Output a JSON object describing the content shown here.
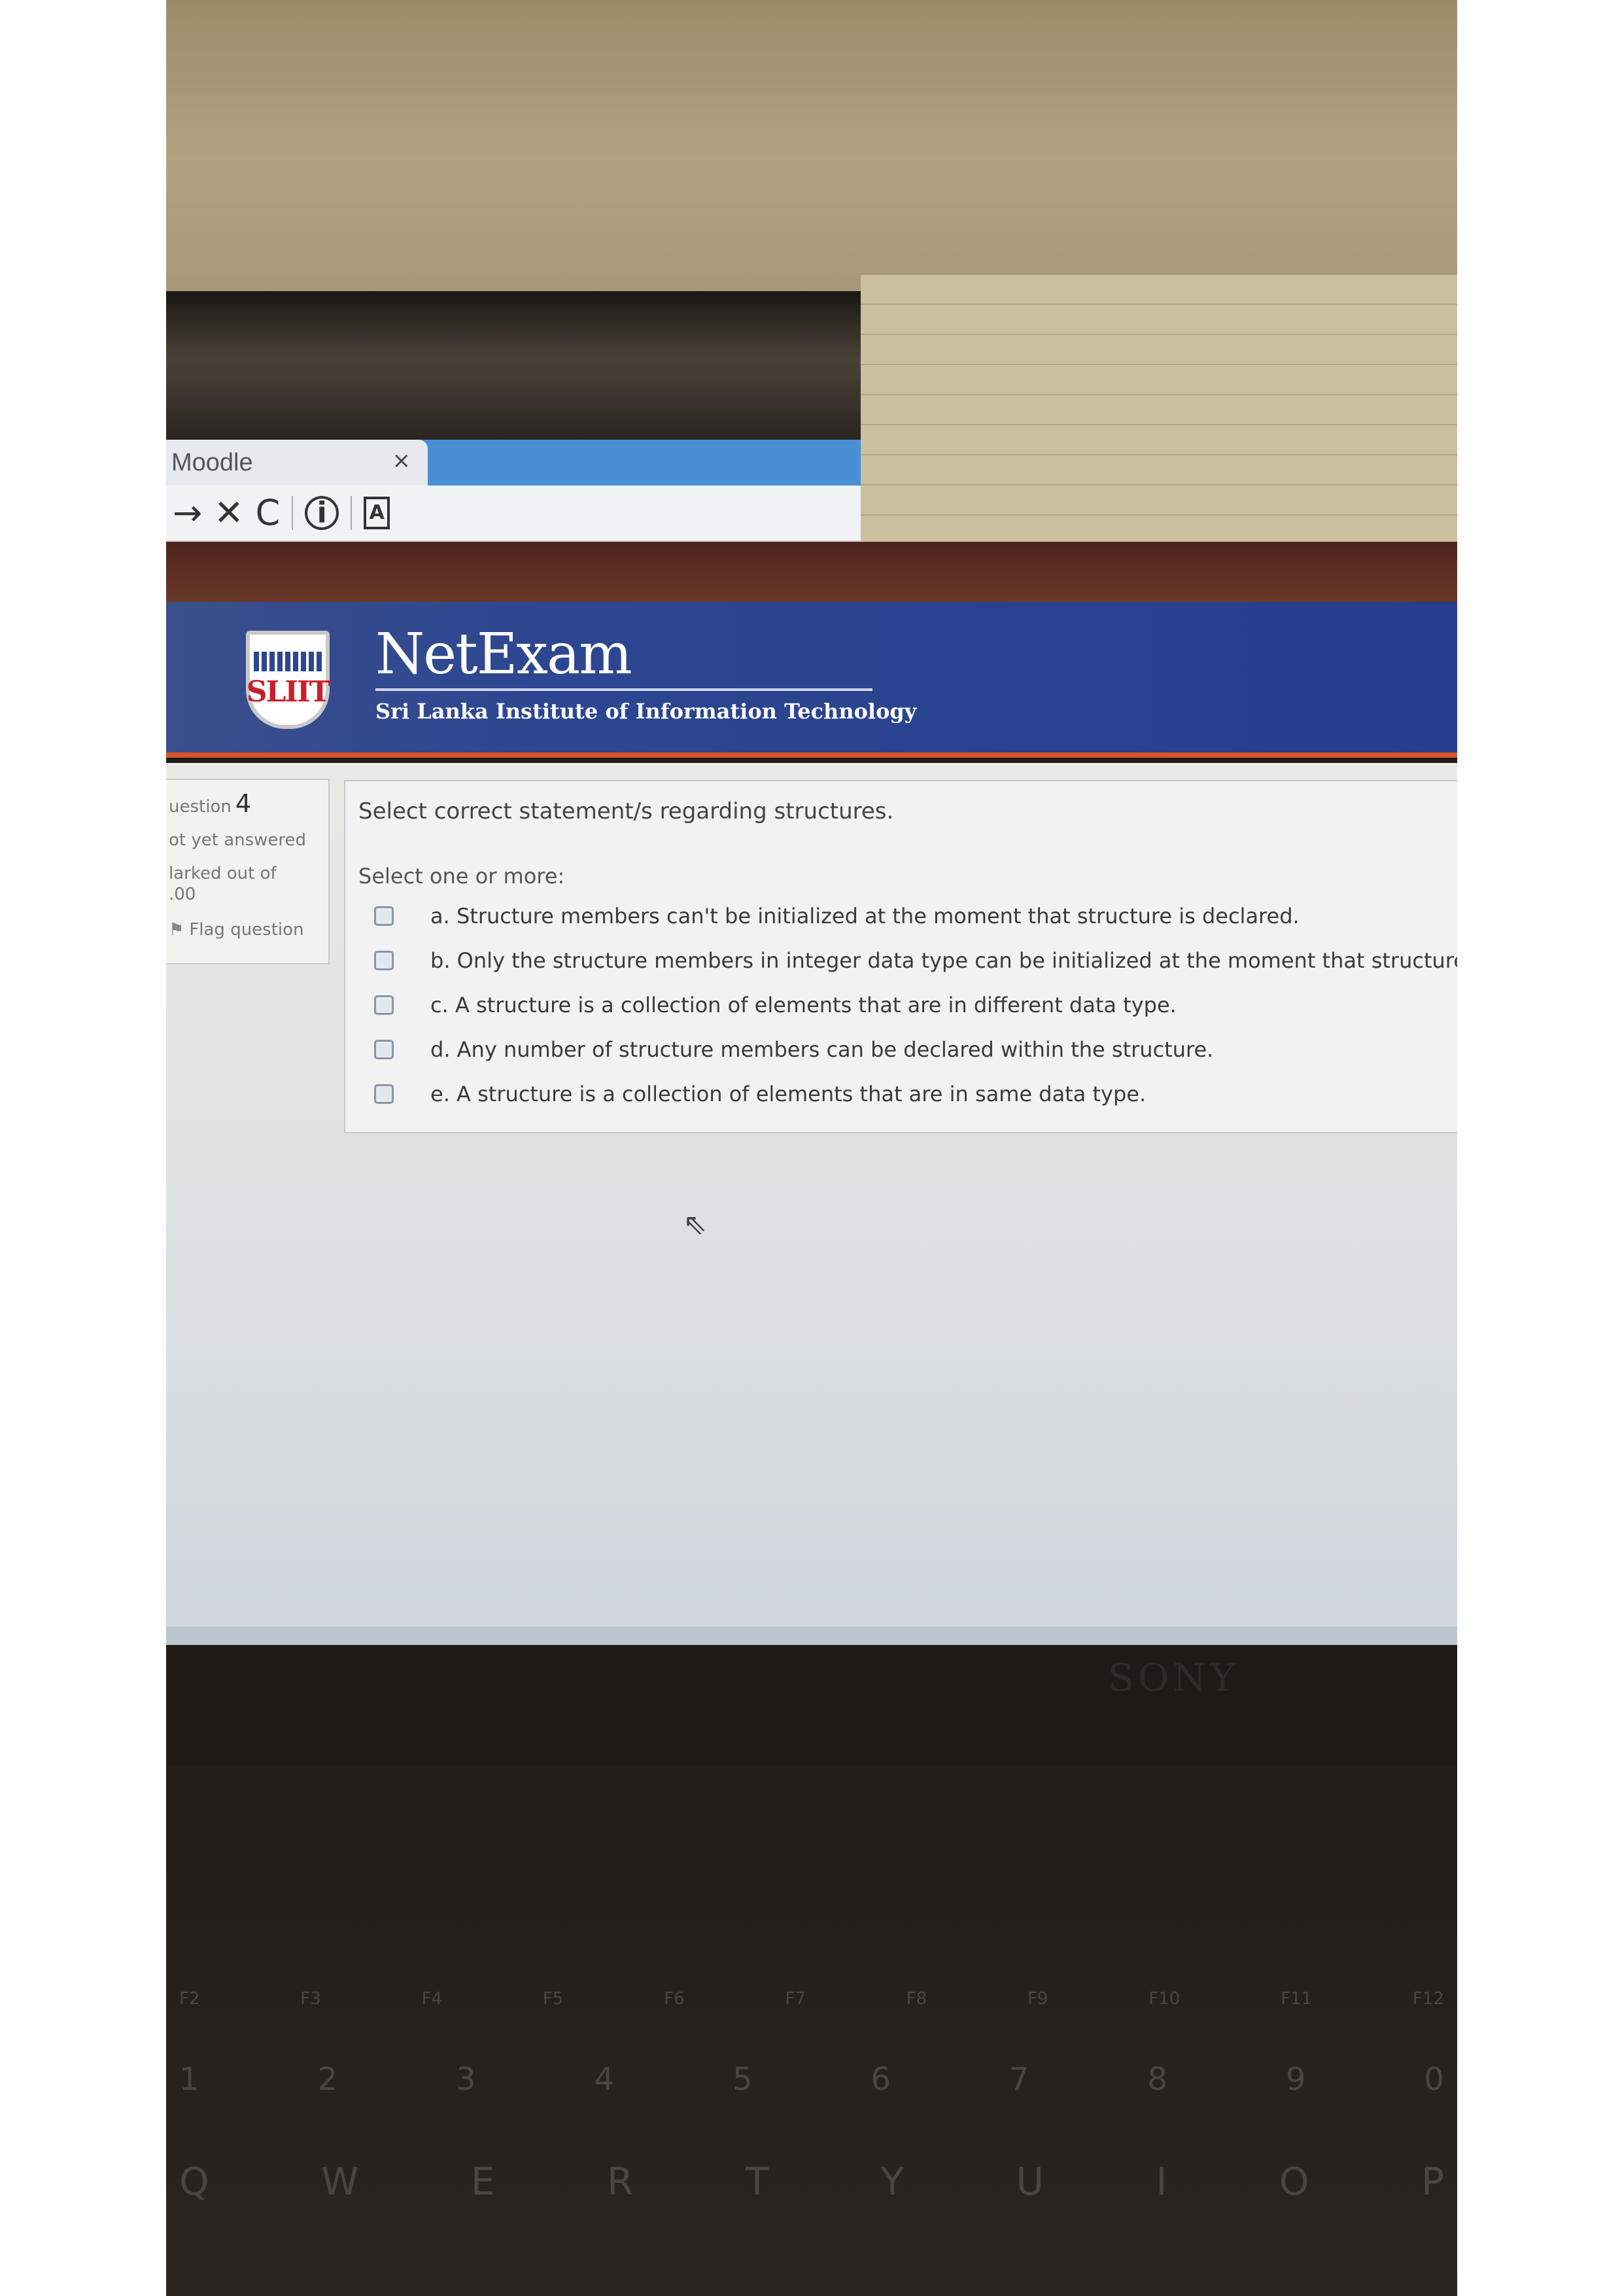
{
  "browser": {
    "tab_title": "Moodle",
    "tab_close": "×",
    "nav": {
      "forward_glyph": "→",
      "stop_glyph": "✕",
      "reload_glyph": "C",
      "info_glyph": "i",
      "reader_glyph": "A"
    }
  },
  "header": {
    "logo_text": "SLIIT",
    "brand": "NetExam",
    "institute": "Sri Lanka Institute of Information Technology"
  },
  "question_info": {
    "question_label": "uestion",
    "question_number": "4",
    "status": "ot yet answered",
    "marked_line1": "larked out of",
    "marked_line2": ".00",
    "flag_glyph": "⚑",
    "flag_label": "Flag question"
  },
  "question": {
    "text": "Select correct statement/s regarding structures.",
    "prompt": "Select one or more:",
    "options": [
      {
        "letter": "a.",
        "text": "Structure members can't be initialized at the moment that structure is declared."
      },
      {
        "letter": "b.",
        "text": "Only the structure members in integer data type can be initialized at the moment that structure"
      },
      {
        "letter": "c.",
        "text": "A structure is a collection of elements that are in  different data type."
      },
      {
        "letter": "d.",
        "text": "Any number of structure members can be declared within the structure."
      },
      {
        "letter": "e.",
        "text": "A structure is a collection of elements that are in  same data type."
      }
    ]
  },
  "cursor_glyph": "⇖",
  "laptop_brand": "SONY",
  "keyboard": {
    "function_row": [
      "F2",
      "F3",
      "F4",
      "F5",
      "F6",
      "F7",
      "F8",
      "F9",
      "F10",
      "F11",
      "F12"
    ],
    "number_row": [
      "1",
      "2",
      "3",
      "4",
      "5",
      "6",
      "7",
      "8",
      "9",
      "0"
    ],
    "letter_row": [
      "Q",
      "W",
      "E",
      "R",
      "T",
      "Y",
      "U",
      "I",
      "O",
      "P"
    ]
  }
}
